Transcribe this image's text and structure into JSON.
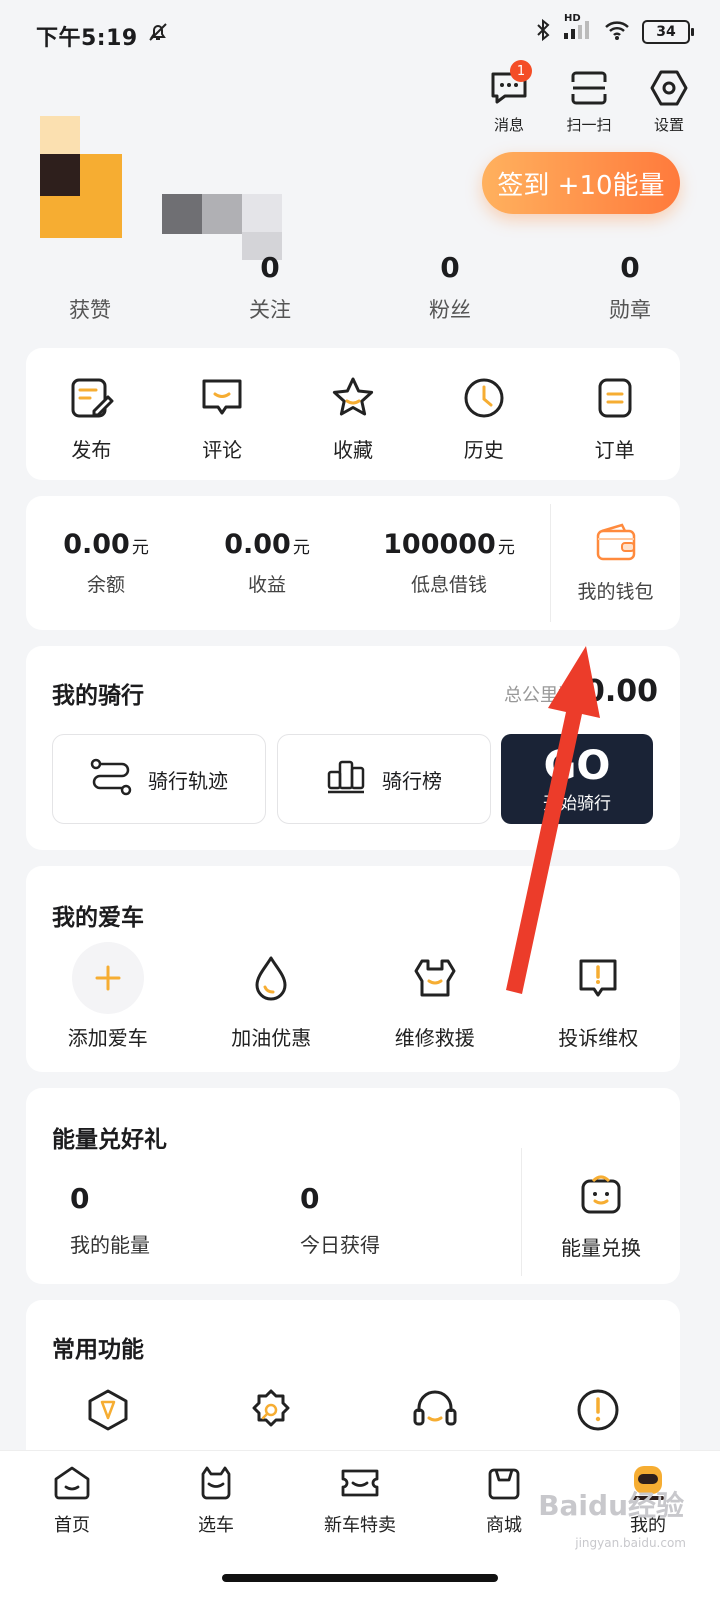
{
  "status": {
    "time": "下午5:19",
    "network": "HD",
    "battery": "34"
  },
  "top_actions": {
    "messages": {
      "label": "消息",
      "badge": "1"
    },
    "scan": {
      "label": "扫一扫"
    },
    "settings": {
      "label": "设置"
    }
  },
  "checkin": {
    "label": "签到 +10能量"
  },
  "stats": [
    {
      "value": "",
      "label": "获赞"
    },
    {
      "value": "0",
      "label": "关注"
    },
    {
      "value": "0",
      "label": "粉丝"
    },
    {
      "value": "0",
      "label": "勋章"
    }
  ],
  "quick": [
    {
      "label": "发布",
      "icon": "edit-icon"
    },
    {
      "label": "评论",
      "icon": "comment-icon"
    },
    {
      "label": "收藏",
      "icon": "star-icon"
    },
    {
      "label": "历史",
      "icon": "clock-icon"
    },
    {
      "label": "订单",
      "icon": "order-icon"
    }
  ],
  "wallet": {
    "balance": {
      "value": "0.00",
      "unit": "元",
      "label": "余额"
    },
    "income": {
      "value": "0.00",
      "unit": "元",
      "label": "收益"
    },
    "loan": {
      "value": "100000",
      "unit": "元",
      "label": "低息借钱"
    },
    "wallet_label": "我的钱包"
  },
  "riding": {
    "title": "我的骑行",
    "total_label": "总公里数",
    "total_value": "0.00",
    "track_label": "骑行轨迹",
    "rank_label": "骑行榜",
    "go_label": "GO",
    "go_sub": "开始骑行"
  },
  "cars": {
    "title": "我的爱车",
    "items": [
      {
        "label": "添加爱车"
      },
      {
        "label": "加油优惠"
      },
      {
        "label": "维修救援"
      },
      {
        "label": "投诉维权"
      }
    ]
  },
  "energy": {
    "title": "能量兑好礼",
    "mine": {
      "value": "0",
      "label": "我的能量"
    },
    "today": {
      "value": "0",
      "label": "今日获得"
    },
    "exchange_label": "能量兑换"
  },
  "common": {
    "title": "常用功能"
  },
  "tabbar": [
    {
      "label": "首页"
    },
    {
      "label": "选车"
    },
    {
      "label": "新车特卖"
    },
    {
      "label": "商城"
    },
    {
      "label": "我的"
    }
  ],
  "watermark": {
    "text": "Baidu经验",
    "sub": "jingyan.baidu.com"
  },
  "colors": {
    "accent": "#ff8a3d",
    "icon_orange": "#f6ad32",
    "dark": "#1a2336",
    "arrow": "#ec3c2a"
  }
}
